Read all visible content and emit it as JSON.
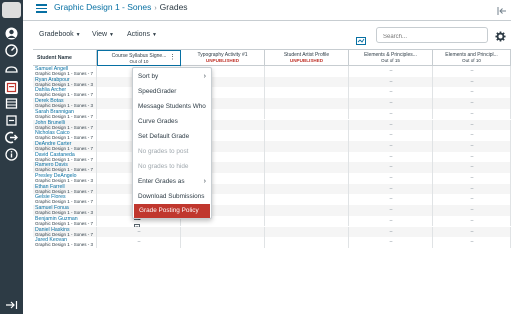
{
  "header": {
    "course_link": "Graphic Design 1 - Sones",
    "separator": "›",
    "current_page": "Grades"
  },
  "toolbar": {
    "gradebook_label": "Gradebook",
    "view_label": "View",
    "actions_label": "Actions",
    "search_placeholder": "Search..."
  },
  "columns": [
    {
      "title": "Student Name",
      "sub": ""
    },
    {
      "title": "Course Syllabus Signe...",
      "sub": "Out of 10"
    },
    {
      "title": "Typography Activity #1",
      "sub": "UNPUBLISHED"
    },
    {
      "title": "Student Artist Profile",
      "sub": "UNPUBLISHED"
    },
    {
      "title": "Elements & Principles...",
      "sub": "Out of 15"
    },
    {
      "title": "Elements and Principl...",
      "sub": "Out of 10"
    }
  ],
  "students": [
    {
      "name": "Samuel Angell",
      "section": "Graphic Design 1 - Sones - 7",
      "syllabus": ""
    },
    {
      "name": "Ryan Arabpour",
      "section": "Graphic Design 1 - Sones - 3",
      "syllabus": ""
    },
    {
      "name": "Dahlia Archer",
      "section": "Graphic Design 1 - Sones - 7",
      "syllabus": ""
    },
    {
      "name": "Derek Botas",
      "section": "Graphic Design 1 - Sones - 3",
      "syllabus": ""
    },
    {
      "name": "Sarah Brannigan",
      "section": "Graphic Design 1 - Sones - 7",
      "syllabus": ""
    },
    {
      "name": "John Brunelli",
      "section": "Graphic Design 1 - Sones - 7",
      "syllabus": ""
    },
    {
      "name": "Nicholas Caico",
      "section": "Graphic Design 1 - Sones - 7",
      "syllabus": ""
    },
    {
      "name": "DeAndre Carter",
      "section": "Graphic Design 1 - Sones - 7",
      "syllabus": ""
    },
    {
      "name": "David Castaneda",
      "section": "Graphic Design 1 - Sones - 7",
      "syllabus": ""
    },
    {
      "name": "Ramero Davis",
      "section": "Graphic Design 1 - Sones - 7",
      "syllabus": ""
    },
    {
      "name": "Presley DeAngelo",
      "section": "Graphic Design 1 - Sones - 3",
      "syllabus": ""
    },
    {
      "name": "Ethan Farrell",
      "section": "Graphic Design 1 - Sones - 7",
      "syllabus": "–"
    },
    {
      "name": "Gelsie Flores",
      "section": "Graphic Design 1 - Sones - 7",
      "syllabus": "icon"
    },
    {
      "name": "Samuel Fonua",
      "section": "Graphic Design 1 - Sones - 3",
      "syllabus": "icon"
    },
    {
      "name": "Benjamin Guzman",
      "section": "Graphic Design 1 - Sones - 7",
      "syllabus": "icon"
    },
    {
      "name": "Daniel Haskins",
      "section": "Graphic Design 1 - Sones - 7",
      "syllabus": "–"
    },
    {
      "name": "Jared Keovan",
      "section": "Graphic Design 1 - Sones - 3",
      "syllabus": "–"
    }
  ],
  "dropdown": {
    "items": [
      {
        "label": "Sort by",
        "arrow": "›",
        "disabled": false,
        "selected": false
      },
      {
        "label": "SpeedGrader",
        "arrow": "",
        "disabled": false,
        "selected": false
      },
      {
        "label": "Message Students Who",
        "arrow": "",
        "disabled": false,
        "selected": false
      },
      {
        "label": "Curve Grades",
        "arrow": "",
        "disabled": false,
        "selected": false
      },
      {
        "label": "Set Default Grade",
        "arrow": "",
        "disabled": false,
        "selected": false
      },
      {
        "label": "No grades to post",
        "arrow": "",
        "disabled": true,
        "selected": false
      },
      {
        "label": "No grades to hide",
        "arrow": "",
        "disabled": true,
        "selected": false
      },
      {
        "label": "Enter Grades as",
        "arrow": "›",
        "disabled": false,
        "selected": false
      },
      {
        "label": "Download Submissions",
        "arrow": "",
        "disabled": false,
        "selected": false
      },
      {
        "label": "Grade Posting Policy",
        "arrow": "",
        "disabled": false,
        "selected": true
      }
    ]
  },
  "icons": {
    "hamburger": "hamburger-icon",
    "gear": "gear-icon",
    "collapse": "collapse-icon"
  },
  "colors": {
    "link": "#0770a3",
    "nav_bg": "#2d3b45",
    "unpublished": "#c0372e",
    "selected_item": "#c0372e"
  }
}
